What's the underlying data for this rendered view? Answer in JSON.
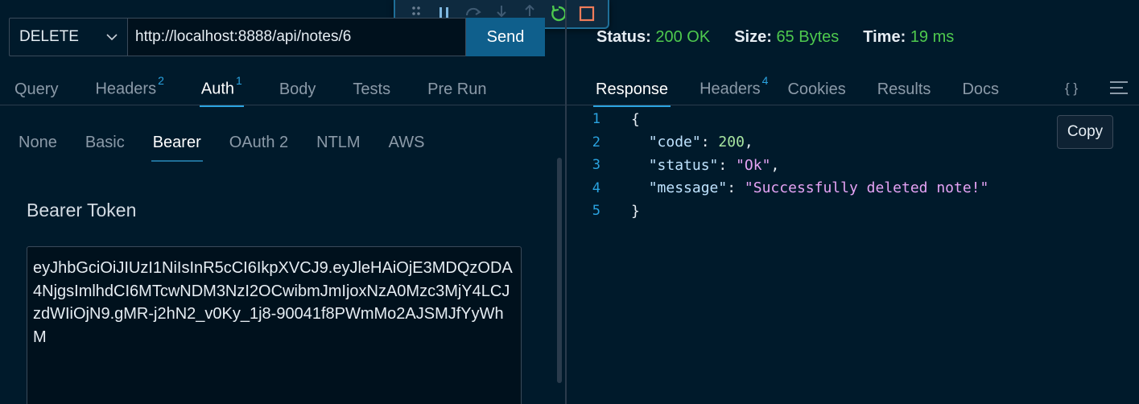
{
  "request": {
    "method": "DELETE",
    "url": "http://localhost:8888/api/notes/6",
    "send_label": "Send"
  },
  "request_tabs": [
    {
      "label": "Query",
      "badge": ""
    },
    {
      "label": "Headers",
      "badge": "2"
    },
    {
      "label": "Auth",
      "badge": "1",
      "active": true
    },
    {
      "label": "Body",
      "badge": ""
    },
    {
      "label": "Tests",
      "badge": ""
    },
    {
      "label": "Pre Run",
      "badge": ""
    }
  ],
  "auth_tabs": [
    {
      "label": "None"
    },
    {
      "label": "Basic"
    },
    {
      "label": "Bearer",
      "active": true
    },
    {
      "label": "OAuth 2"
    },
    {
      "label": "NTLM"
    },
    {
      "label": "AWS"
    }
  ],
  "bearer": {
    "label": "Bearer Token",
    "token": "eyJhbGciOiJIUzI1NiIsInR5cCI6IkpXVCJ9.eyJleHAiOjE3MDQzODA4NjgsImlhdCI6MTcwNDM3NzI2OCwibmJmIjoxNzA0Mzc3MjY4LCJzdWIiOjN9.gMR-j2hN2_v0Ky_1j8-90041f8PWmMo2AJSMJfYyWhM"
  },
  "status": {
    "status_label": "Status:",
    "status_value": "200 OK",
    "size_label": "Size:",
    "size_value": "65 Bytes",
    "time_label": "Time:",
    "time_value": "19 ms"
  },
  "response_tabs": [
    {
      "label": "Response",
      "badge": "",
      "active": true
    },
    {
      "label": "Headers",
      "badge": "4"
    },
    {
      "label": "Cookies",
      "badge": ""
    },
    {
      "label": "Results",
      "badge": ""
    },
    {
      "label": "Docs",
      "badge": ""
    }
  ],
  "response_icons": {
    "braces": "{ }"
  },
  "response_body": {
    "line_numbers": [
      "1",
      "2",
      "3",
      "4",
      "5"
    ],
    "open": "{",
    "close": "}",
    "fields": [
      {
        "key": "\"code\"",
        "value": "200",
        "type": "num"
      },
      {
        "key": "\"status\"",
        "value": "\"Ok\"",
        "type": "str"
      },
      {
        "key": "\"message\"",
        "value": "\"Successfully deleted note!\"",
        "type": "str"
      }
    ]
  },
  "copy_label": "Copy",
  "colors": {
    "background": "#001a2b",
    "accent": "#2aa3e0",
    "send_button": "#0f5f8c",
    "success": "#4ec94e"
  },
  "icons": {
    "debug_toolbar": [
      "drag-handle-icon",
      "pause-icon",
      "step-over-icon",
      "step-into-icon",
      "step-out-icon",
      "restart-icon",
      "stop-icon"
    ]
  }
}
